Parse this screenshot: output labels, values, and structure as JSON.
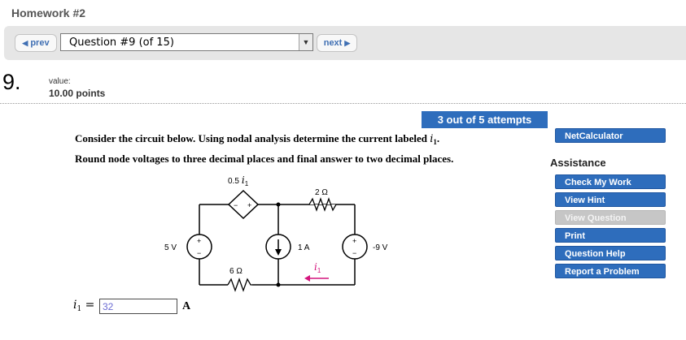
{
  "header": {
    "title": "Homework #2"
  },
  "nav": {
    "prev_label": "prev",
    "next_label": "next",
    "question_select": "Question #9 (of 15)"
  },
  "question": {
    "number": "9.",
    "value_label": "value:",
    "points": "10.00 points",
    "attempts": "3 out of 5 attempts",
    "prompt_line1": "Consider the circuit below. Using nodal analysis determine the current labeled",
    "prompt_var": "i",
    "prompt_sub": "1",
    "prompt_end": ".",
    "prompt_line2": "Round node voltages to three decimal places and final answer to two decimal places."
  },
  "circuit": {
    "dep_source_coef": "0.5",
    "dep_source_var": "i",
    "dep_source_sub": "1",
    "r_top": "2 Ω",
    "r_bottom": "6 Ω",
    "v_left": "5 V",
    "current_source": "1 A",
    "v_right": "-9 V",
    "i1_label": "i",
    "i1_sub": "1",
    "plus": "+",
    "minus": "−"
  },
  "answer": {
    "var": "i",
    "sub": "1",
    "equals": "=",
    "value": "32",
    "unit": "A"
  },
  "sidebar": {
    "netcalc": "NetCalculator",
    "assistance_title": "Assistance",
    "check_work": "Check My Work",
    "view_hint": "View Hint",
    "view_question": "View Question",
    "print": "Print",
    "question_help": "Question Help",
    "report_problem": "Report a Problem"
  },
  "colors": {
    "accent": "#2e6dbc",
    "disabled": "#c6c6c6",
    "link": "#3f6fb3",
    "current_arrow": "#d4157d"
  }
}
